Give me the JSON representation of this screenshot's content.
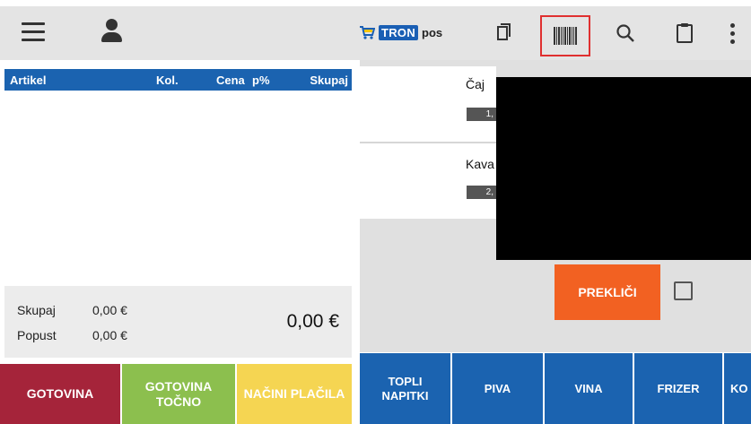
{
  "topbar": {
    "logo": {
      "brand": "TRON",
      "product": "pos"
    }
  },
  "icons": {
    "menu": "hamburger-icon",
    "user": "user-icon",
    "copy": "copy-icon",
    "barcode": "barcode-icon",
    "search": "search-icon",
    "clipboard": "clipboard-icon",
    "more": "more-vertical-icon"
  },
  "colors": {
    "primary_blue": "#1b63b0",
    "gotovina": "#a5243a",
    "gotovina_tocno": "#8cbf4e",
    "nacini_placila": "#f5d552",
    "preklici": "#f26122",
    "highlight_border": "#e03030"
  },
  "receipt": {
    "columns": [
      "Artikel",
      "Kol.",
      "Cena",
      "p%",
      "Skupaj"
    ],
    "rows": []
  },
  "totals": {
    "skupaj_label": "Skupaj",
    "skupaj_value": "0,00 €",
    "popust_label": "Popust",
    "popust_value": "0,00 €",
    "grand_total": "0,00 €"
  },
  "payment_buttons": {
    "gotovina": "GOTOVINA",
    "gotovina_tocno_line1": "GOTOVINA",
    "gotovina_tocno_line2": "TOČNO",
    "nacini_placila": "NAČINI PLAČILA"
  },
  "products": [
    {
      "name": "Čaj",
      "price": "1,"
    },
    {
      "name": "Kava",
      "price": "2,"
    }
  ],
  "scanner": {
    "cancel_label": "PREKLIČI"
  },
  "categories": {
    "topli_line1": "TOPLI",
    "topli_line2": "NAPITKI",
    "piva": "PIVA",
    "vina": "VINA",
    "frizer": "FRIZER",
    "ko": "KO"
  }
}
